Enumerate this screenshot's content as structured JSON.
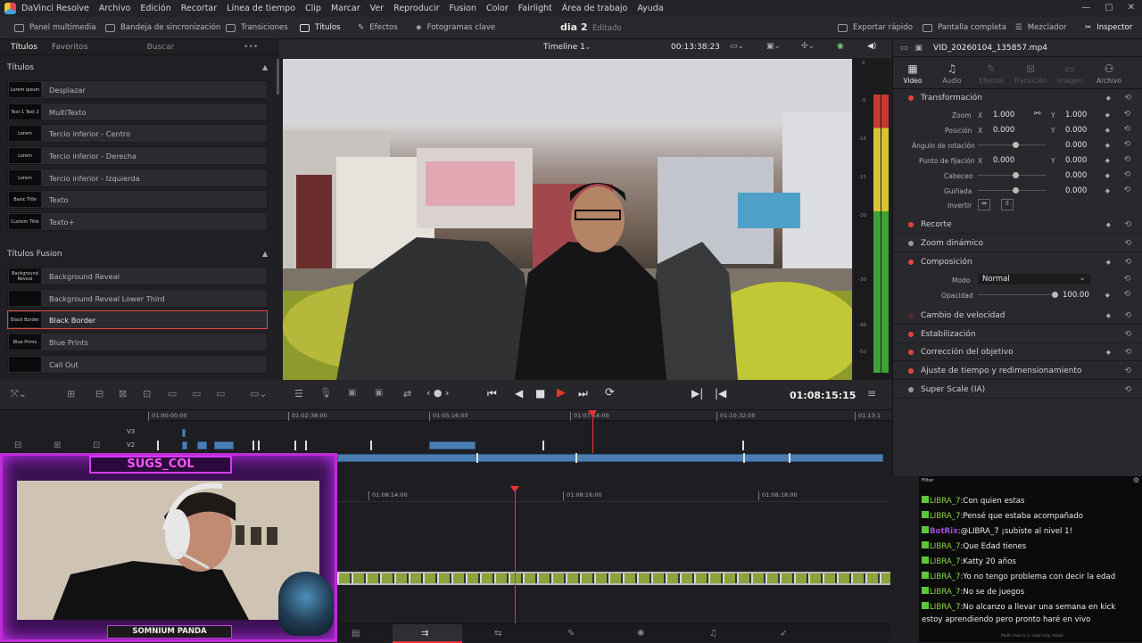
{
  "menubar": {
    "app_title": "DaVinci Resolve",
    "items": [
      "Archivo",
      "Edición",
      "Recortar",
      "Línea de tiempo",
      "Clip",
      "Marcar",
      "Ver",
      "Reproducir",
      "Fusion",
      "Color",
      "Fairlight",
      "Área de trabajo",
      "Ayuda"
    ],
    "win": [
      "—",
      "▢",
      "✕"
    ]
  },
  "toolbar": {
    "media": "Panel multimedia",
    "sync": "Bandeja de sincronización",
    "transitions": "Transiciones",
    "titles": "Títulos",
    "effects": "Efectos",
    "keyframes": "Fotogramas clave",
    "project": "dia 2",
    "status": "Editado",
    "export": "Exportar rápido",
    "fullscreen": "Pantalla completa",
    "mixer": "Mezclador",
    "inspector": "Inspector"
  },
  "left": {
    "tab1": "Títulos",
    "tab2": "Favoritos",
    "search": "Buscar",
    "sect1": "Títulos",
    "titles": [
      {
        "label": "Desplazar",
        "thumb": "Lorem ipsum"
      },
      {
        "label": "MultiTexto",
        "thumb": "Text 1 Text 2"
      },
      {
        "label": "Tercio inferior - Centro",
        "thumb": "Lorem"
      },
      {
        "label": "Tercio inferior - Derecha",
        "thumb": "Lorem"
      },
      {
        "label": "Tercio inferior - Izquierda",
        "thumb": "Lorem"
      },
      {
        "label": "Texto",
        "thumb": "Basic Title"
      },
      {
        "label": "Texto+",
        "thumb": "Custom Title"
      }
    ],
    "sect2": "Títulos Fusion",
    "fusion": [
      {
        "label": "Background Reveal",
        "thumb": "Background Reveal"
      },
      {
        "label": "Background Reveal Lower Third",
        "thumb": ""
      },
      {
        "label": "Black Border",
        "thumb": "Black Border"
      },
      {
        "label": "Blue Prints",
        "thumb": "Blue Prints"
      },
      {
        "label": "Call Out",
        "thumb": ""
      }
    ]
  },
  "viewer": {
    "timeline_name": "Timeline 1",
    "timecode_top": "00:13:38:23",
    "timecode": "01:08:15:15"
  },
  "timeline": {
    "ruler1": [
      "01:00:00:00",
      "01:02:38:00",
      "01:05:16:00",
      "01:07:54:00",
      "01:10:32:00",
      "01:13:1"
    ],
    "ruler2": [
      "01:08:14:00",
      "01:08:16:00",
      "01:08:18:00"
    ],
    "tracks": [
      "V3",
      "V2"
    ]
  },
  "inspector": {
    "filename": "VID_20260104_135857.mp4",
    "tabs": [
      "Video",
      "Audio",
      "Efectos",
      "Transición",
      "Imagen",
      "Archivo"
    ],
    "transform": "Transformación",
    "zoom": "Zoom",
    "zoom_x": "1.000",
    "zoom_y": "1.000",
    "position": "Posición",
    "pos_x": "0.000",
    "pos_y": "0.000",
    "rotation": "Ángulo de rotación",
    "rot": "0.000",
    "anchor": "Punto de fijación",
    "anc_x": "0.000",
    "anc_y": "0.000",
    "pitch": "Cabeceo",
    "pitch_v": "0.000",
    "yaw": "Guiñada",
    "yaw_v": "0.000",
    "flip": "Invertir",
    "x": "X",
    "y": "Y",
    "crop": "Recorte",
    "dynzoom": "Zoom dinámico",
    "composite": "Composición",
    "mode": "Modo",
    "mode_v": "Normal",
    "opacity": "Opacidad",
    "opacity_v": "100.00",
    "speed": "Cambio de velocidad",
    "stab": "Estabilización",
    "lens": "Corrección del objetivo",
    "retime": "Ajuste de tiempo y redimensionamiento",
    "superscale": "Super Scale (IA)"
  },
  "meter_ticks": [
    "0",
    "-5",
    "-10",
    "-15",
    "-20",
    "-30",
    "-40",
    "-50"
  ],
  "chat": {
    "filter": "Filter",
    "footer": "Multi-chat is in read only mode",
    "lines": [
      {
        "user": "LIBRA_7",
        "text": "Con quien estas"
      },
      {
        "user": "LIBRA_7",
        "text": "Pensé que estaba acompañado"
      },
      {
        "user": "BotRix",
        "text": "@LIBRA_7 ¡subiste al nivel 1!"
      },
      {
        "user": "LIBRA_7",
        "text": "Que Edad tienes"
      },
      {
        "user": "LIBRA_7",
        "text": "Katty 20 años"
      },
      {
        "user": "LIBRA_7",
        "text": "Yo no tengo problema con decir la edad"
      },
      {
        "user": "LIBRA_7",
        "text": "No se de juegos"
      },
      {
        "user": "LIBRA_7",
        "text": "No alcanzo a llevar una semana en kick"
      },
      {
        "user": "",
        "text": "estoy aprendiendo pero pronto haré en vivo"
      }
    ]
  },
  "webcam": {
    "name": "SUGS_COL",
    "subtitle": "SOMNIUM PANDA"
  },
  "colors": {
    "accent": "#e0463d",
    "clip": "#4b7fb3",
    "overlay": "#c12bd8"
  }
}
